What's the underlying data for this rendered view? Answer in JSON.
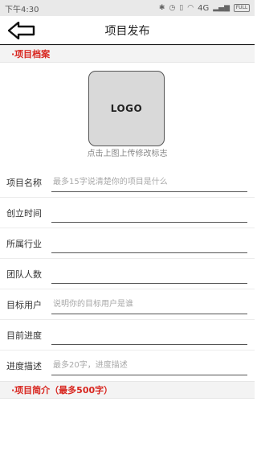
{
  "status_bar": {
    "time": "下午4:30",
    "icons": [
      "bluetooth-icon",
      "alarm-icon",
      "mute-icon",
      "wifi-icon"
    ],
    "network": "4G",
    "battery": "FULL"
  },
  "nav": {
    "title": "项目发布",
    "back_icon": "arrow-left-icon"
  },
  "sections": {
    "profile_title": "·项目档案",
    "intro_title": "·项目简介（最多500字）"
  },
  "logo": {
    "text": "LOGO",
    "hint": "点击上图上传修改标志"
  },
  "form": [
    {
      "label": "项目名称",
      "placeholder": "最多15字说清楚你的项目是什么",
      "value": ""
    },
    {
      "label": "创立时间",
      "placeholder": "",
      "value": ""
    },
    {
      "label": "所属行业",
      "placeholder": "",
      "value": ""
    },
    {
      "label": "团队人数",
      "placeholder": "",
      "value": ""
    },
    {
      "label": "目标用户",
      "placeholder": "说明你的目标用户是谁",
      "value": ""
    },
    {
      "label": "目前进度",
      "placeholder": "",
      "value": ""
    },
    {
      "label": "进度描述",
      "placeholder": "最多20字，进度描述",
      "value": ""
    }
  ],
  "colors": {
    "accent": "#d8261f",
    "status_bg": "#e9e9e9",
    "section_bg": "#f3f3f3",
    "logo_bg": "#d9d9d9"
  }
}
